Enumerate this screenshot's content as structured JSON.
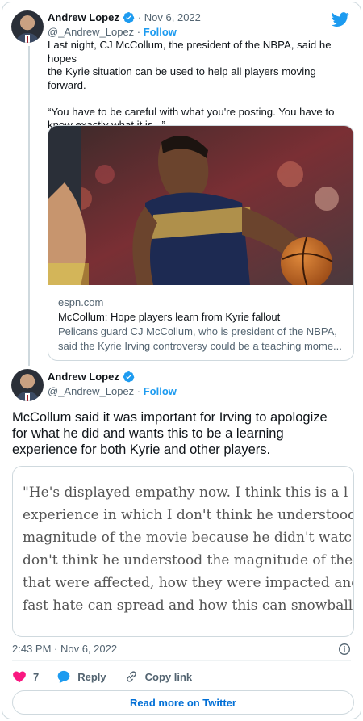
{
  "tweet1": {
    "author_name": "Andrew Lopez",
    "date": "· Nov 6, 2022",
    "handle": "@_Andrew_Lopez",
    "separator": " · ",
    "follow_label": "Follow",
    "text_lines": [
      "Last night, CJ McCollum, the president of the NBPA, said he hopes",
      "the Kyrie situation can be used to help all players moving",
      "forward.",
      "",
      "“You have to be careful with what you're posting. You have to",
      "know exactly what it is...”"
    ],
    "link_card": {
      "domain": "espn.com",
      "title": "McCollum: Hope players learn from Kyrie fallout",
      "description_lines": [
        "Pelicans guard CJ McCollum, who is president of the NBPA,",
        "said the Kyrie Irving controversy could be a teaching mome..."
      ]
    }
  },
  "tweet2": {
    "author_name": "Andrew Lopez",
    "handle": "@_Andrew_Lopez",
    "separator": " · ",
    "follow_label": "Follow",
    "text_lines": [
      "McCollum said it was important for Irving to apologize",
      "for what he did and wants this to be a learning",
      "experience for both Kyrie and other players."
    ],
    "quote_image_lines": [
      "\"He's displayed empathy now. I think this is a l",
      "experience in which I don't think he understood",
      "magnitude of the movie because he didn't watc",
      "don't think he understood the magnitude of the",
      "that were affected, how they were impacted and",
      "fast hate can spread and how this can snowball"
    ],
    "timestamp": "2:43 PM · Nov 6, 2022",
    "actions": {
      "like_count": "7",
      "reply_label": "Reply",
      "copy_link_label": "Copy link"
    },
    "read_more_label": "Read more on Twitter"
  },
  "colors": {
    "accent": "#1d9bf0",
    "link_blue": "#006fd6",
    "like_pink": "#f91880",
    "secondary_text": "#536471",
    "border": "#cfd9de"
  },
  "icons": [
    "twitter-bird-icon",
    "verified-badge-icon",
    "heart-icon",
    "reply-bubble-icon",
    "link-icon",
    "info-icon"
  ]
}
